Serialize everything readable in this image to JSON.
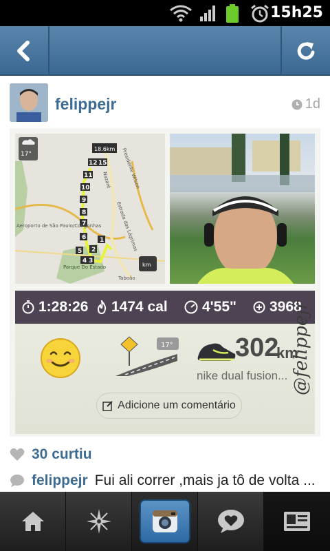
{
  "status_bar": {
    "time": "15h25",
    "icons": [
      "wifi-icon",
      "signal-icon",
      "battery-icon",
      "alarm-icon"
    ]
  },
  "nav": {
    "back_icon": "chevron-left-icon",
    "refresh_icon": "refresh-icon"
  },
  "post": {
    "username": "felippejr",
    "time_ago": "1d",
    "likes": "30 curtiu",
    "caption_user": "felippejr",
    "caption_text": "Fui ali correr ,mais ja tô de volta ..."
  },
  "photo": {
    "map": {
      "temperature": "17°",
      "distance_badge": "18.6km",
      "km_button": "km",
      "labels": [
        "Aeroporto de São Paulo/Congonhas",
        "Parque Do Estado",
        "Taboão",
        "Estrada das Lágrimas",
        "Presidente Wilson",
        "Nazaré"
      ],
      "markers": [
        "1",
        "2",
        "3",
        "4",
        "5",
        "6",
        "7",
        "8",
        "9",
        "10",
        "11",
        "12",
        "15"
      ]
    },
    "stats": {
      "time": "1:28:26",
      "calories": "1474 cal",
      "pace": "4'55\"",
      "fuel": "3968"
    },
    "weather_temp": "17°",
    "distance_value": "302",
    "distance_unit": "km",
    "shoe_name": "nike dual fusion...",
    "comment_button": "Adicione um comentário",
    "watermark": "@felippejr"
  },
  "tabs": [
    {
      "name": "home",
      "icon": "home-icon"
    },
    {
      "name": "explore",
      "icon": "compass-icon"
    },
    {
      "name": "camera",
      "icon": "camera-icon"
    },
    {
      "name": "activity",
      "icon": "heart-bubble-icon"
    },
    {
      "name": "profile",
      "icon": "profile-card-icon"
    }
  ],
  "colors": {
    "accent": "#3d6b92",
    "navbar": "#4a7aa3",
    "stats_bar": "#4e4352",
    "route": "#e8f43a"
  }
}
